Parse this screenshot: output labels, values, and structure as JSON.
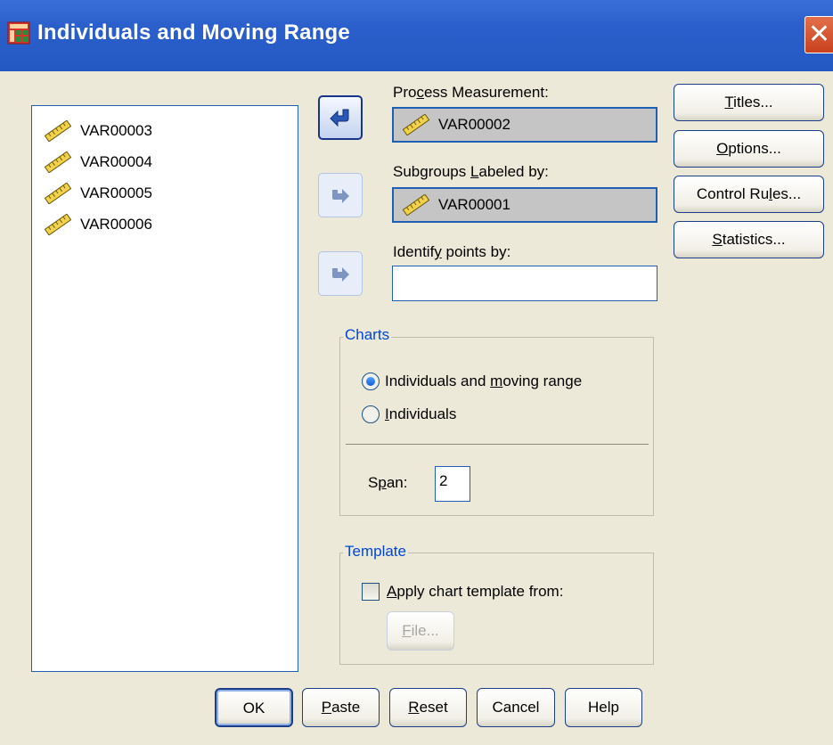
{
  "window": {
    "title": "Individuals and Moving Range",
    "close_label": "✕"
  },
  "variables_list": [
    "VAR00003",
    "VAR00004",
    "VAR00005",
    "VAR00006"
  ],
  "process_measurement": {
    "label_pre": "Pro",
    "label_u": "c",
    "label_post": "ess Measurement:",
    "value": "VAR00002"
  },
  "subgroups": {
    "label_pre": "Subgroups ",
    "label_u": "L",
    "label_post": "abeled by:",
    "value": "VAR00001"
  },
  "identify": {
    "label_pre": "Identif",
    "label_u": "y",
    "label_post": " points by:",
    "value": ""
  },
  "side_buttons": {
    "titles": {
      "pre": "",
      "u": "T",
      "post": "itles..."
    },
    "options": {
      "pre": "",
      "u": "O",
      "post": "ptions..."
    },
    "control_rules": {
      "pre": "Control Ru",
      "u": "l",
      "post": "es..."
    },
    "statistics": {
      "pre": "",
      "u": "S",
      "post": "tatistics..."
    }
  },
  "charts": {
    "legend": "Charts",
    "option1": {
      "pre": "Individuals and ",
      "u": "m",
      "post": "oving range",
      "selected": true
    },
    "option2": {
      "pre": "",
      "u": "I",
      "post": "ndividuals",
      "selected": false
    },
    "span_label_pre": "S",
    "span_label_u": "p",
    "span_label_post": "an:",
    "span_value": "2"
  },
  "template": {
    "legend": "Template",
    "checkbox": {
      "pre": "",
      "u": "A",
      "post": "pply chart template from:",
      "checked": false
    },
    "file_button": {
      "pre": "",
      "u": "F",
      "post": "ile..."
    }
  },
  "bottom_buttons": {
    "ok": "OK",
    "paste": {
      "pre": "",
      "u": "P",
      "post": "aste"
    },
    "reset": {
      "pre": "",
      "u": "R",
      "post": "eset"
    },
    "cancel": "Cancel",
    "help": "Help"
  },
  "icons": {
    "app": "table-icon",
    "variable": "ruler-icon",
    "arrow_left": "move-left-arrow-icon",
    "arrow_right": "move-right-arrow-icon"
  },
  "colors": {
    "titlebar": "#2458c2",
    "dialog_bg": "#ece9d8",
    "field_border": "#1f5fb4",
    "legend_text": "#0046d5"
  }
}
